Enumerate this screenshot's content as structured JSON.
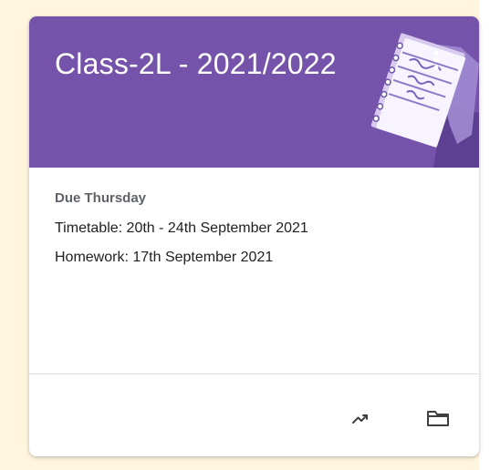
{
  "card": {
    "title": "Class-2L - 2021/2022",
    "header_color": "#7553aa",
    "header_illustration": "notebook-illustration",
    "more_icon": "more-vert-icon"
  },
  "due": {
    "label": "Due Thursday",
    "assignments": [
      "Timetable: 20th - 24th September 2021",
      "Homework: 17th September 2021"
    ]
  },
  "footer": {
    "icons": [
      "trending-up-icon",
      "folder-icon"
    ]
  },
  "colors": {
    "page_background": "#fff6dd",
    "card_background": "#ffffff",
    "primary_text": "#202124",
    "secondary_text": "#5f6368",
    "icon": "#3c4043"
  }
}
